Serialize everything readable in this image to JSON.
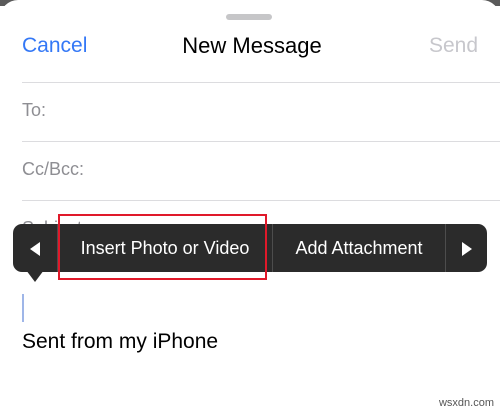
{
  "nav": {
    "cancel_label": "Cancel",
    "title": "New Message",
    "send_label": "Send"
  },
  "fields": {
    "to_label": "To:",
    "cc_label": "Cc/Bcc:",
    "subject_label": "Subject:"
  },
  "body": {
    "signature": "Sent from my iPhone"
  },
  "context_menu": {
    "prev_icon": "chevron-left-icon",
    "next_icon": "chevron-right-icon",
    "items": [
      {
        "label": "Insert Photo or Video"
      },
      {
        "label": "Add Attachment"
      }
    ]
  },
  "watermark": "wsxdn.com",
  "colors": {
    "accent": "#3478f6",
    "disabled": "#c7c7cc",
    "menu_background": "#2b2b2b",
    "annotation_box": "#e0192a"
  }
}
